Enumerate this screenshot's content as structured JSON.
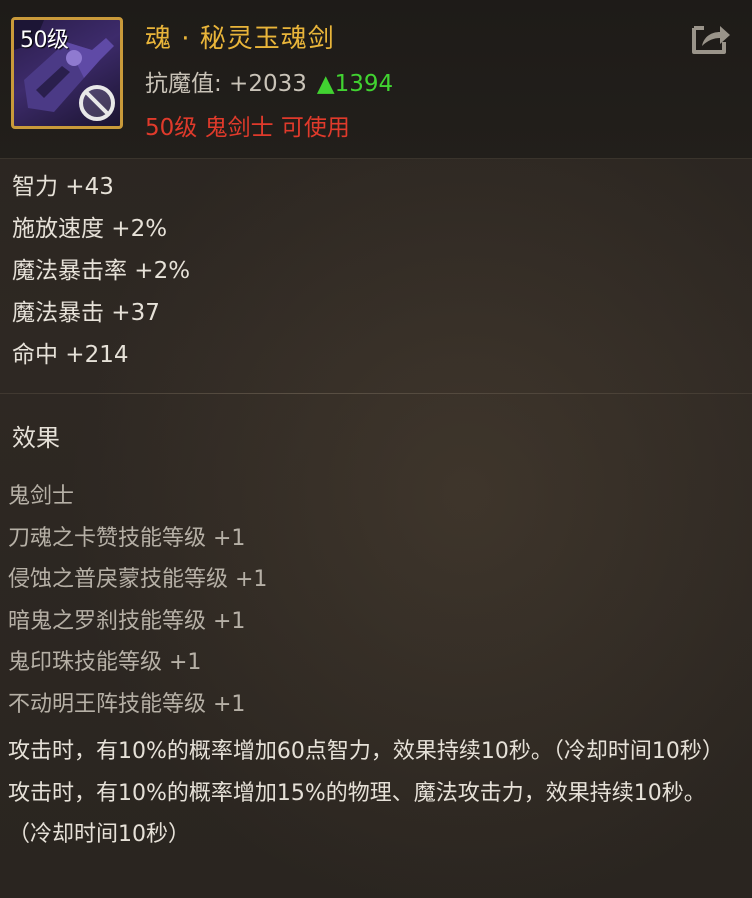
{
  "item": {
    "level_badge": "50级",
    "name": "魂 · 秘灵玉魂剑",
    "resist_label": "抗魔值: +2033",
    "resist_up": "▲1394",
    "requirement": "50级 鬼剑士 可使用"
  },
  "stats": [
    "智力 +43",
    "施放速度 +2%",
    "魔法暴击率 +2%",
    "魔法暴击 +37",
    "命中 +214"
  ],
  "effect_title": "效果",
  "effects": {
    "class_name": "鬼剑士",
    "skills": [
      "刀魂之卡赞技能等级 +1",
      "侵蚀之普戾蒙技能等级 +1",
      "暗鬼之罗刹技能等级 +1",
      "鬼印珠技能等级 +1",
      "不动明王阵技能等级 +1"
    ],
    "descriptions": [
      "攻击时，有10%的概率增加60点智力，效果持续10秒。（冷却时间10秒）",
      "攻击时，有10%的概率增加15%的物理、魔法攻击力，效果持续10秒。（冷却时间10秒）"
    ]
  },
  "colors": {
    "name_gold": "#e9b53a",
    "up_green": "#41d331",
    "requirement_red": "#e03a2b",
    "frame_gold": "#c99a3a"
  },
  "icons": {
    "item": "weapon-item-icon",
    "disabled": "ban-icon",
    "share": "share-icon"
  }
}
